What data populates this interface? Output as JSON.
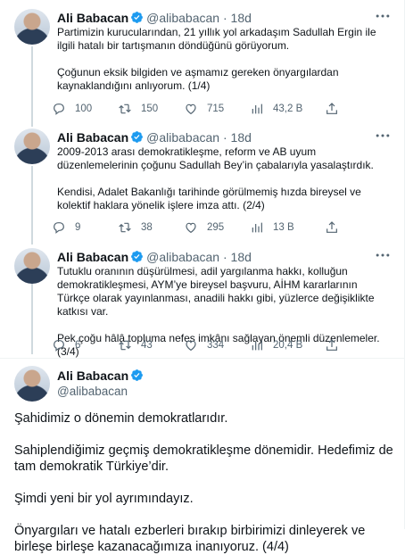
{
  "tweets": [
    {
      "name": "Ali Babacan",
      "handle": "@alibabacan",
      "dot": "·",
      "time": "18d",
      "paragraphs": [
        "Partimizin kurucularından, 21 yıllık yol arkadaşım Sadullah Ergin ile ilgili hatalı bir tartışmanın döndüğünü görüyorum.",
        "Çoğunun eksik bilgiden ve aşmamız gereken önyargılardan kaynaklandığını anlıyorum. (1/4)"
      ],
      "reply": "100",
      "retweet": "150",
      "like": "715",
      "views": "43,2 B"
    },
    {
      "name": "Ali Babacan",
      "handle": "@alibabacan",
      "dot": "·",
      "time": "18d",
      "paragraphs": [
        "2009-2013 arası demokratikleşme, reform ve AB uyum düzenlemelerinin çoğunu Sadullah Bey’in çabalarıyla yasalaştırdık.",
        "Kendisi, Adalet Bakanlığı tarihinde görülmemiş hızda bireysel ve kolektif haklara yönelik işlere imza attı. (2/4)"
      ],
      "reply": "9",
      "retweet": "38",
      "like": "295",
      "views": "13 B"
    },
    {
      "name": "Ali Babacan",
      "handle": "@alibabacan",
      "dot": "·",
      "time": "18d",
      "paragraphs": [
        "Tutuklu oranının düşürülmesi, adil yargılanma hakkı, kolluğun demokratikleşmesi, AYM’ye bireysel başvuru, AİHM kararlarının Türkçe olarak yayınlanması, anadili hakkı gibi, yüzlerce değişiklikte katkısı var.",
        "Pek çoğu hâlâ topluma nefes imkânı sağlayan önemli düzenlemeler.(3/4)"
      ],
      "reply": "6",
      "retweet": "43",
      "like": "334",
      "views": "20,4 B"
    }
  ],
  "main_tweet": {
    "name": "Ali Babacan",
    "handle": "@alibabacan",
    "paragraphs": [
      "Şahidimiz o dönemin demokratlarıdır.",
      "Sahiplendiğimiz geçmiş demokratikleşme dönemidir. Hedefimiz de tam demokratik Türkiye’dir.",
      "Şimdi yeni bir yol ayrımındayız.",
      "Önyargıları ve hatalı ezberleri bırakıp birbirimizi dinleyerek ve birleşe birleşe kazanacağımıza inanıyoruz. (4/4)"
    ]
  },
  "colors": {
    "verified": "#1d9bf0",
    "secondary": "#536471",
    "thread_line": "#cfd9de"
  },
  "icons": {
    "verified": "verified-badge-icon",
    "more": "more-icon",
    "reply": "reply-icon",
    "retweet": "retweet-icon",
    "like": "like-icon",
    "views": "views-icon",
    "share": "share-icon"
  }
}
